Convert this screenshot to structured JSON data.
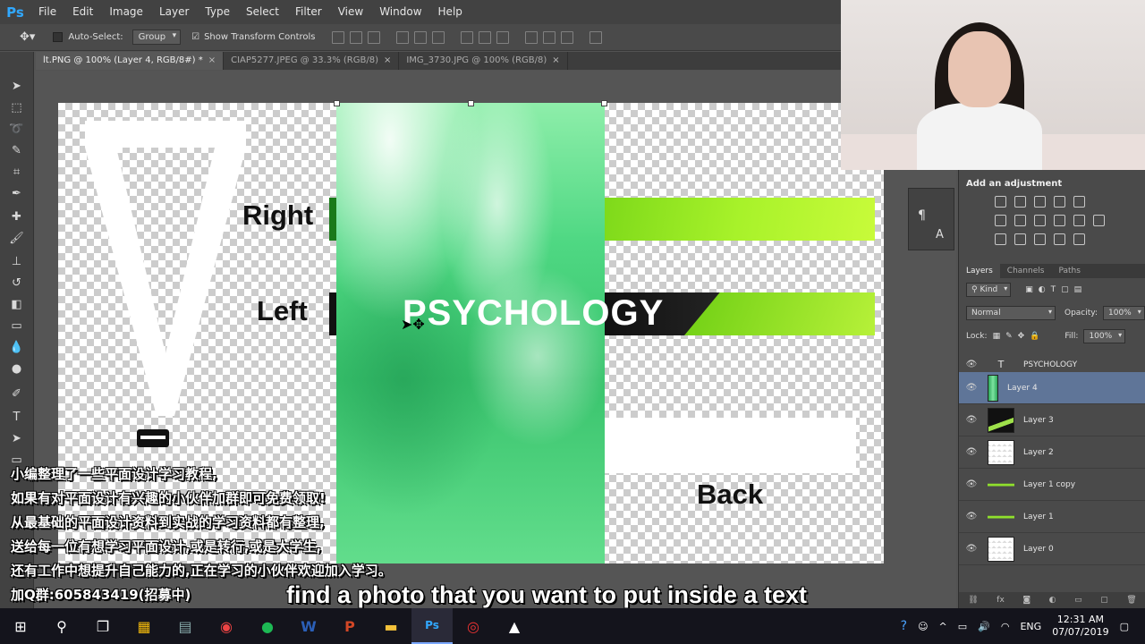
{
  "app": {
    "logo": "Ps"
  },
  "menu": [
    "File",
    "Edit",
    "Image",
    "Layer",
    "Type",
    "Select",
    "Filter",
    "View",
    "Window",
    "Help"
  ],
  "options": {
    "auto_select_label": "Auto-Select:",
    "group_value": "Group",
    "transform_label": "Show Transform Controls"
  },
  "tabs": [
    {
      "label": "lt.PNG @ 100% (Layer 4, RGB/8#) *",
      "close": "×"
    },
    {
      "label": "CIAP5277.JPEG @ 33.3% (RGB/8)",
      "close": "×"
    },
    {
      "label": "IMG_3730.JPG @ 100% (RGB/8)",
      "close": "×"
    }
  ],
  "canvas": {
    "right": "Right",
    "left": "Left",
    "back": "Back",
    "psychology": "PSYCHOLOGY"
  },
  "adjustments": {
    "title": "Add an adjustment"
  },
  "layers_panel": {
    "tabs": [
      "Layers",
      "Channels",
      "Paths"
    ],
    "kind": "Kind",
    "blend_mode": "Normal",
    "opacity_label": "Opacity:",
    "opacity_value": "100%",
    "lock_label": "Lock:",
    "fill_label": "Fill:",
    "fill_value": "100%",
    "layers": [
      {
        "name": "PSYCHOLOGY",
        "type": "text"
      },
      {
        "name": "Layer 4",
        "selected": true
      },
      {
        "name": "Layer 3"
      },
      {
        "name": "Layer 2"
      },
      {
        "name": "Layer 1 copy"
      },
      {
        "name": "Layer 1"
      },
      {
        "name": "Layer 0"
      }
    ],
    "bottom_icons": [
      "link-icon",
      "fx-icon",
      "mask-icon",
      "adjustment-icon",
      "folder-icon",
      "new-layer-icon",
      "trash-icon"
    ],
    "fx_label": "fx"
  },
  "overlay_lines": [
    "小编整理了一些平面设计学习教程,",
    "如果有对平面设计有兴趣的小伙伴加群即可免费领取!",
    "从最基础的平面设计资料到实战的学习资料都有整理,",
    "送给每一位有想学习平面设计,或是转行,或是大学生,",
    "还有工作中想提升自己能力的,正在学习的小伙伴欢迎加入学习。",
    "加Q群:605843419(招募中)"
  ],
  "subtitle": "find a photo that you want to put inside a text",
  "taskbar": {
    "language": "ENG",
    "time": "12:31 AM",
    "date": "07/07/2019"
  }
}
